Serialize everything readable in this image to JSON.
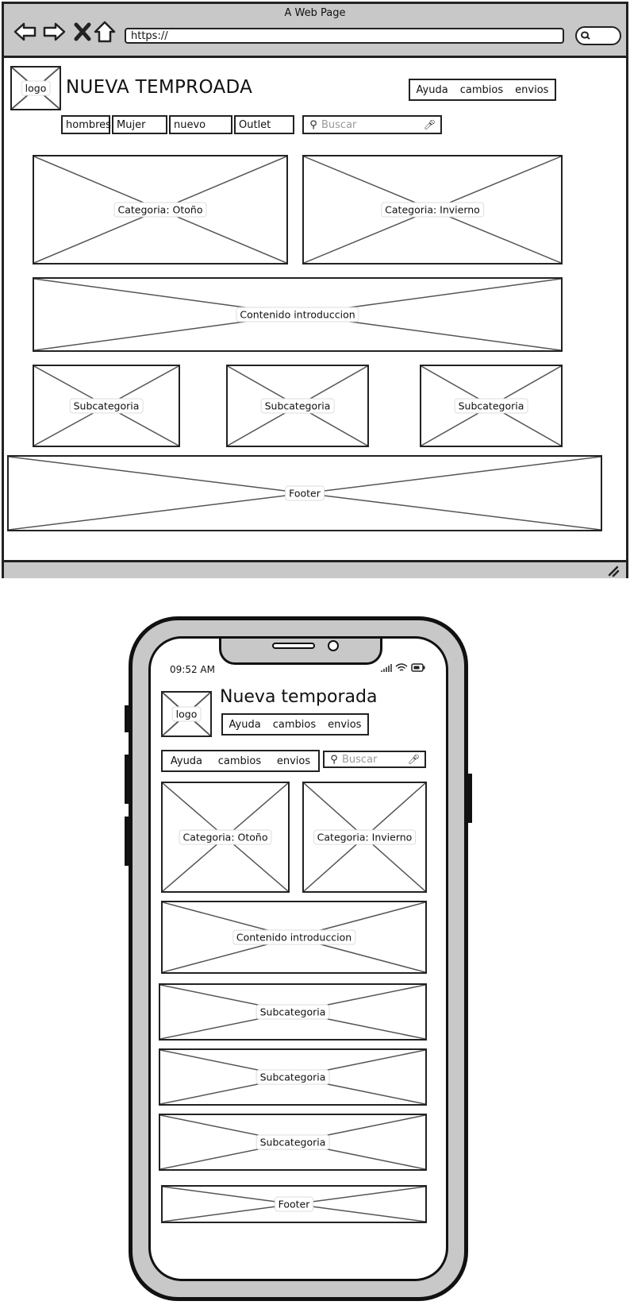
{
  "desktop": {
    "window_title": "A Web Page",
    "url": "https://",
    "logo_label": "logo",
    "page_title": "NUEVA TEMPROADA",
    "top_links": [
      "Ayuda",
      "cambios",
      "envios"
    ],
    "nav": [
      "hombres",
      "Mujer",
      "nuevo",
      "Outlet"
    ],
    "search_placeholder": "Buscar",
    "category_1": "Categoria: Otoño",
    "category_2": "Categoria: Invierno",
    "intro": "Contenido introduccion",
    "subcategories": [
      "Subcategoria",
      "Subcategoria",
      "Subcategoria"
    ],
    "footer": "Footer",
    "icons": [
      "back-arrow-icon",
      "forward-arrow-icon",
      "close-x-icon",
      "home-icon",
      "search-icon",
      "microphone-icon",
      "resize-grip-icon"
    ]
  },
  "mobile": {
    "time": "09:52 AM",
    "logo_label": "logo",
    "page_title": "Nueva temporada",
    "header_links": [
      "Ayuda",
      "cambios",
      "envios"
    ],
    "nav_links": [
      "Ayuda",
      "cambios",
      "envios"
    ],
    "search_placeholder": "Buscar",
    "category_1": "Categoria: Otoño",
    "category_2": "Categoria: Invierno",
    "intro": "Contenido introduccion",
    "subcategories": [
      "Subcategoria",
      "Subcategoria",
      "Subcategoria"
    ],
    "footer": "Footer",
    "icons": [
      "signal-icon",
      "wifi-icon",
      "battery-icon",
      "search-icon",
      "microphone-icon"
    ]
  },
  "colors": {
    "chrome_gray": "#c8c8c8",
    "stroke": "#222222",
    "placeholder_cross": "#555555"
  }
}
